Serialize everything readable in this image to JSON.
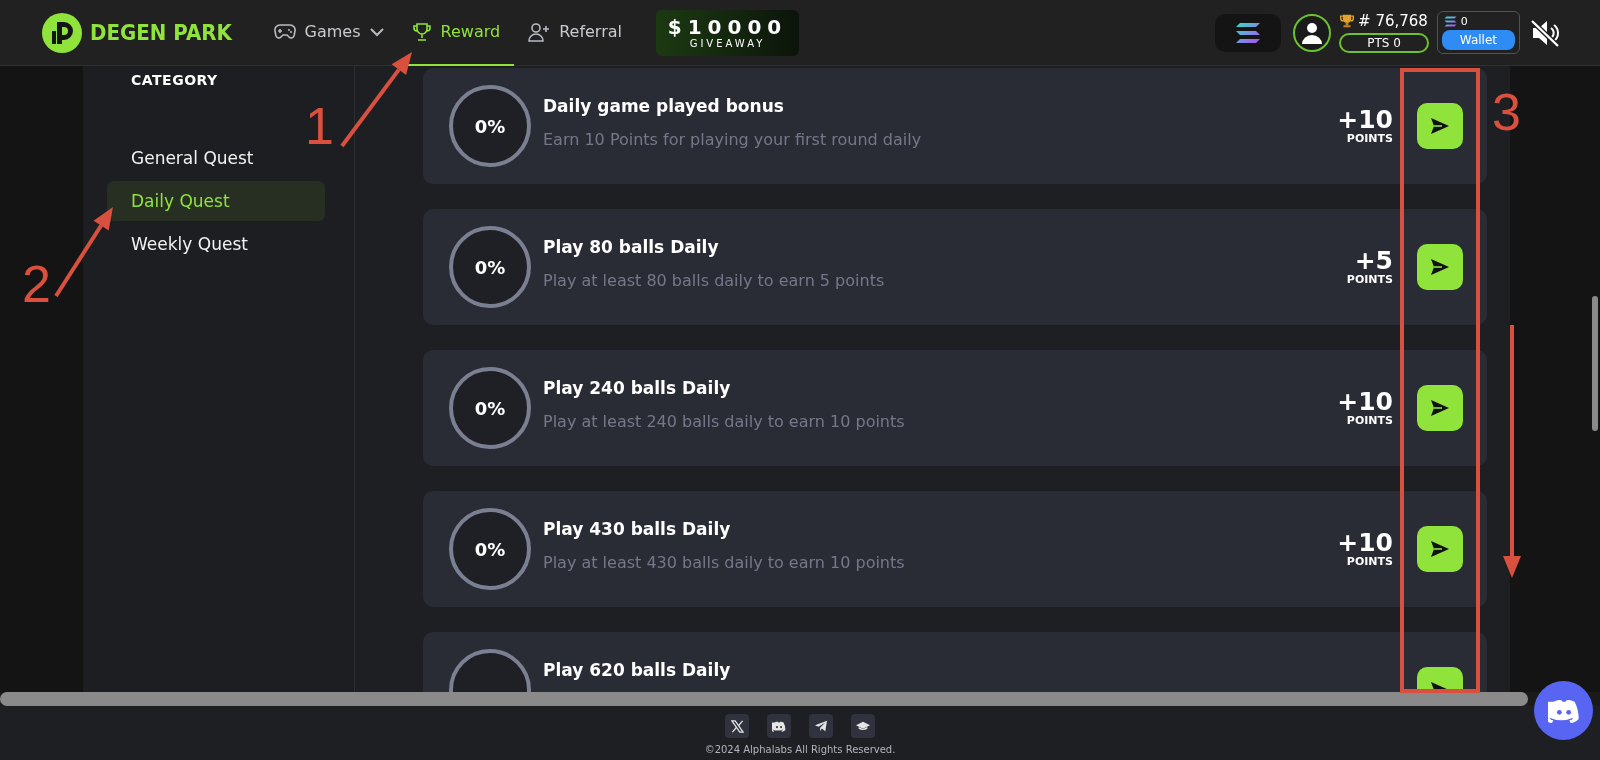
{
  "header": {
    "logo": "DEGEN PARK",
    "nav": [
      {
        "label": "Games",
        "selected": false,
        "has_menu": true
      },
      {
        "label": "Reward",
        "selected": true,
        "has_menu": false
      },
      {
        "label": "Referral",
        "selected": false,
        "has_menu": false
      }
    ],
    "giveaway": {
      "amount": "$10000",
      "label": "GIVEAWAY"
    },
    "rank": "# 76,768",
    "points": "PTS 0",
    "wallet": {
      "balance": "0",
      "button": "Wallet"
    }
  },
  "sidebar": {
    "heading": "CATEGORY",
    "items": [
      {
        "label": "General Quest",
        "selected": false
      },
      {
        "label": "Daily Quest",
        "selected": true
      },
      {
        "label": "Weekly Quest",
        "selected": false
      }
    ]
  },
  "quests": [
    {
      "title": "Daily game played bonus",
      "description": "Earn 10 Points for playing your first round daily",
      "progress": "0%",
      "points": "+10",
      "unit": "POINTS"
    },
    {
      "title": "Play 80 balls Daily",
      "description": "Play at least 80 balls daily to earn 5 points",
      "progress": "0%",
      "points": "+5",
      "unit": "POINTS"
    },
    {
      "title": "Play 240 balls Daily",
      "description": "Play at least 240 balls daily to earn 10 points",
      "progress": "0%",
      "points": "+10",
      "unit": "POINTS"
    },
    {
      "title": "Play 430 balls Daily",
      "description": "Play at least 430 balls daily to earn 10 points",
      "progress": "0%",
      "points": "+10",
      "unit": "POINTS"
    },
    {
      "title": "Play 620 balls Daily"
    }
  ],
  "footer": {
    "copyright": "©2024 Alphalabs All Rights Reserved."
  },
  "annotations": [
    {
      "label": "1"
    },
    {
      "label": "2"
    },
    {
      "label": "3"
    }
  ]
}
